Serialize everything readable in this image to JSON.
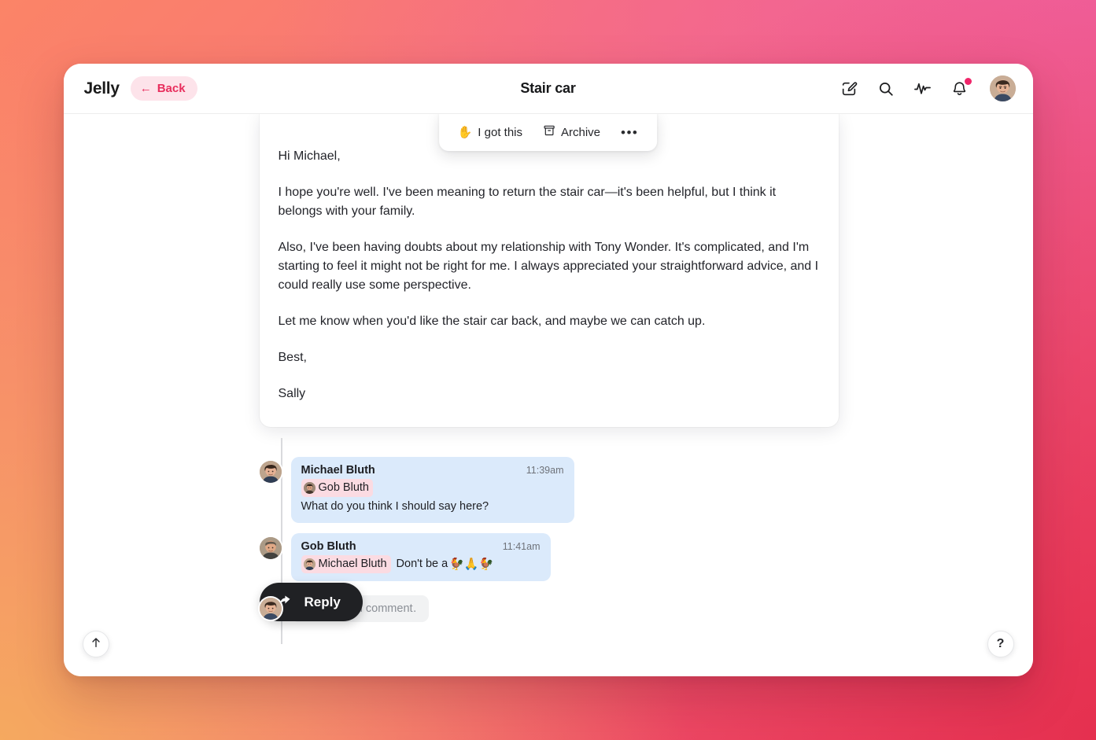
{
  "theme": {
    "accent_pink": "#e82e5d",
    "accent_pink_bg": "#fde3ea",
    "bubble_blue": "#dbeafb",
    "mention_pink": "#fbdbe2",
    "reply_dark": "#202124",
    "notification_dot": "#f0266a",
    "bg_gradient_from": "#fb8467",
    "bg_gradient_to": "#ef4d6e"
  },
  "topbar": {
    "brand": "Jelly",
    "back_label": "Back",
    "back_arrow": "←",
    "title": "Stair car",
    "icons": [
      {
        "name": "compose-icon",
        "title": "Compose"
      },
      {
        "name": "search-icon",
        "title": "Search"
      },
      {
        "name": "activity-icon",
        "title": "Activity"
      },
      {
        "name": "bell-icon",
        "title": "Notifications",
        "has_dot": true
      }
    ],
    "avatar_alt": "Michael Bluth"
  },
  "action_toolbar": {
    "got_this_label": "I got this",
    "got_this_icon": "✋",
    "archive_label": "Archive",
    "archive_icon": "archive-box-icon",
    "more_label": "•••"
  },
  "message": {
    "paragraphs": [
      "Hi Michael,",
      "I hope you're well. I've been meaning to return the stair car—it's been helpful, but I think it belongs with your family.",
      "Also, I've been having doubts about my relationship with Tony Wonder. It's complicated, and I'm starting to feel it might not be right for me. I always appreciated your straightforward advice, and I could really use some perspective.",
      "Let me know when you'd like the stair car back, and maybe we can catch up.",
      "Best,",
      "Sally"
    ]
  },
  "comments": [
    {
      "author": "Michael Bluth",
      "time": "11:39am",
      "mention": "Gob Bluth",
      "text": "What do you think I should say here?",
      "emojis": ""
    },
    {
      "author": "Gob Bluth",
      "time": "11:41am",
      "mention": "Michael Bluth",
      "text": "Don't be a",
      "emojis": "🐓🙏🐓"
    }
  ],
  "composer": {
    "placeholder": "Add internal comment…",
    "value": ""
  },
  "reply": {
    "label": "Reply",
    "icon": "reply-arrow-icon"
  },
  "fabs": {
    "scroll_top_label": "↑",
    "help_label": "?"
  }
}
